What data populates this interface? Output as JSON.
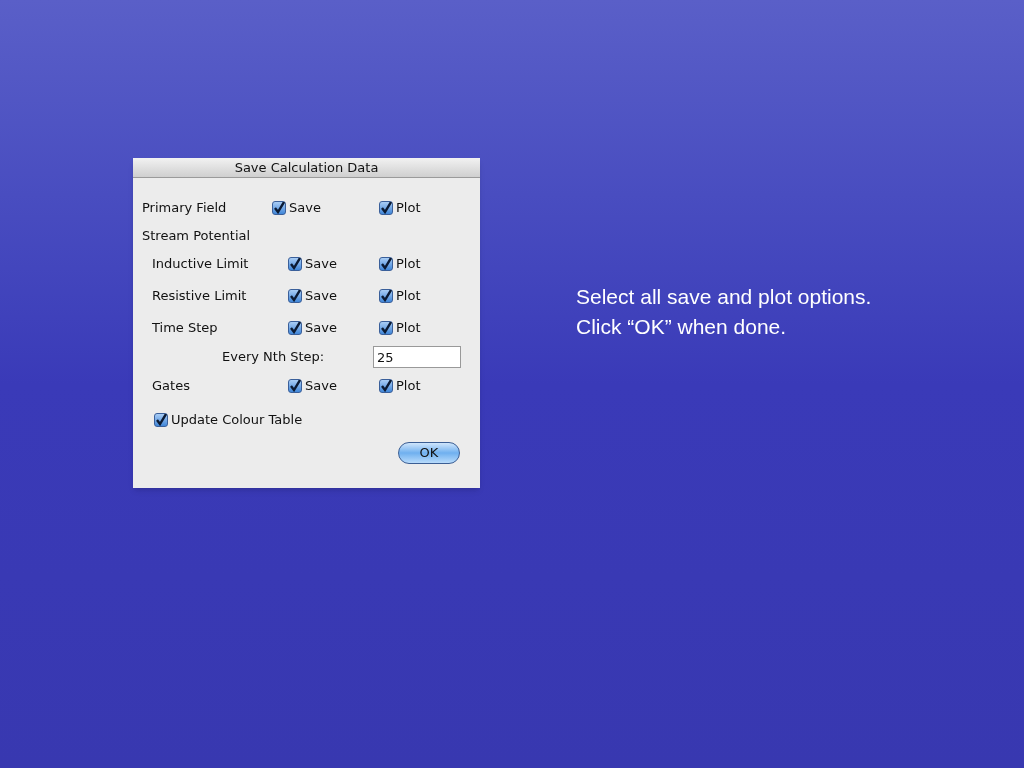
{
  "dialog": {
    "title": "Save Calculation Data",
    "rows": [
      {
        "kind": "options",
        "label": "Primary Field",
        "save": {
          "label": "Save",
          "checked": true
        },
        "plot": {
          "label": "Plot",
          "checked": true
        }
      },
      {
        "kind": "group",
        "label": "Stream Potential",
        "children": [
          {
            "kind": "options",
            "label": "Inductive Limit",
            "save": {
              "label": "Save",
              "checked": true
            },
            "plot": {
              "label": "Plot",
              "checked": true
            }
          },
          {
            "kind": "options",
            "label": "Resistive Limit",
            "save": {
              "label": "Save",
              "checked": true
            },
            "plot": {
              "label": "Plot",
              "checked": true
            }
          },
          {
            "kind": "options",
            "label": "Time Step",
            "save": {
              "label": "Save",
              "checked": true
            },
            "plot": {
              "label": "Plot",
              "checked": true
            }
          },
          {
            "kind": "field",
            "label": "Every Nth Step:",
            "value": "25"
          },
          {
            "kind": "options",
            "label": "Gates",
            "save": {
              "label": "Save",
              "checked": true
            },
            "plot": {
              "label": "Plot",
              "checked": true
            }
          }
        ]
      }
    ],
    "update_colour_table": {
      "label": "Update Colour Table",
      "checked": true
    },
    "ok_button": "OK"
  },
  "instructions": [
    "Select all save and plot options.",
    "Click “OK” when done."
  ]
}
